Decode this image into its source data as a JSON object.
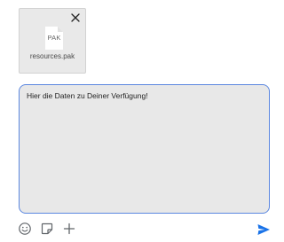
{
  "attachment": {
    "file_extension_label": "PAK",
    "file_name": "resources.pak",
    "remove_icon": "close-icon",
    "file_icon": "document-icon"
  },
  "compose": {
    "message_text": "Hier die Daten zu Deiner Verfügung!"
  },
  "toolbar": {
    "emoji_icon": "emoji-icon",
    "sticker_icon": "sticker-icon",
    "add_icon": "plus-icon",
    "send_icon": "send-icon"
  },
  "colors": {
    "accent": "#1a73e8",
    "focus_border": "#5b87e0",
    "box_background": "#e8e8e8",
    "attachment_background": "#e9e9e9"
  }
}
